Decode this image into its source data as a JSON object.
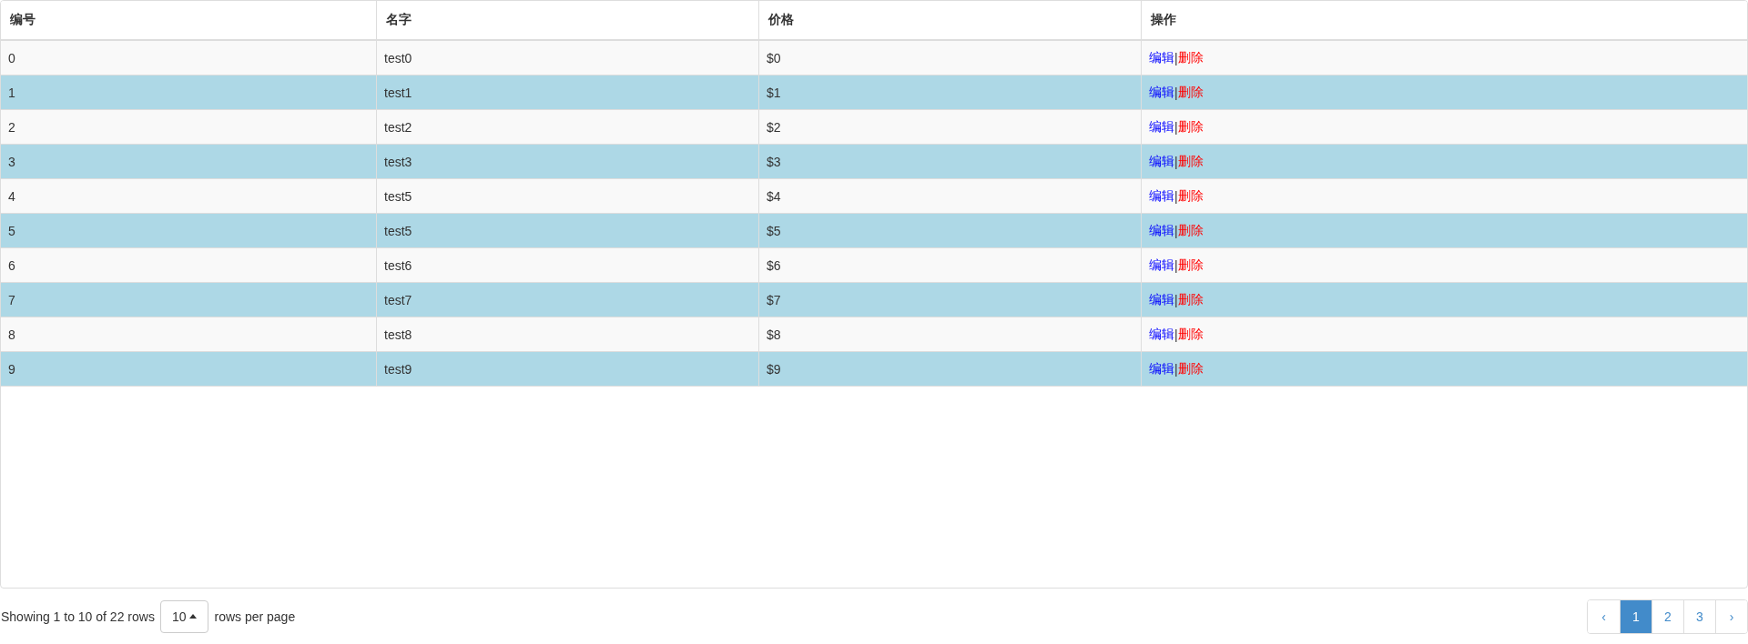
{
  "table": {
    "columns": [
      "编号",
      "名字",
      "价格",
      "操作"
    ],
    "rows": [
      {
        "id": "0",
        "name": "test0",
        "price": "$0",
        "actions": {
          "edit": "编辑",
          "separator": "|",
          "delete": "删除"
        }
      },
      {
        "id": "1",
        "name": "test1",
        "price": "$1",
        "actions": {
          "edit": "编辑",
          "separator": "|",
          "delete": "删除"
        }
      },
      {
        "id": "2",
        "name": "test2",
        "price": "$2",
        "actions": {
          "edit": "编辑",
          "separator": "|",
          "delete": "删除"
        }
      },
      {
        "id": "3",
        "name": "test3",
        "price": "$3",
        "actions": {
          "edit": "编辑",
          "separator": "|",
          "delete": "删除"
        }
      },
      {
        "id": "4",
        "name": "test5",
        "price": "$4",
        "actions": {
          "edit": "编辑",
          "separator": "|",
          "delete": "删除"
        }
      },
      {
        "id": "5",
        "name": "test5",
        "price": "$5",
        "actions": {
          "edit": "编辑",
          "separator": "|",
          "delete": "删除"
        }
      },
      {
        "id": "6",
        "name": "test6",
        "price": "$6",
        "actions": {
          "edit": "编辑",
          "separator": "|",
          "delete": "删除"
        }
      },
      {
        "id": "7",
        "name": "test7",
        "price": "$7",
        "actions": {
          "edit": "编辑",
          "separator": "|",
          "delete": "删除"
        }
      },
      {
        "id": "8",
        "name": "test8",
        "price": "$8",
        "actions": {
          "edit": "编辑",
          "separator": "|",
          "delete": "删除"
        }
      },
      {
        "id": "9",
        "name": "test9",
        "price": "$9",
        "actions": {
          "edit": "编辑",
          "separator": "|",
          "delete": "删除"
        }
      }
    ]
  },
  "footer": {
    "summary": "Showing 1 to 10 of 22 rows",
    "page_size": "10",
    "page_size_suffix": "rows per page",
    "pagination": [
      {
        "label": "‹",
        "selected": false
      },
      {
        "label": "1",
        "selected": true
      },
      {
        "label": "2",
        "selected": false
      },
      {
        "label": "3",
        "selected": false
      },
      {
        "label": "›",
        "selected": false
      }
    ]
  }
}
